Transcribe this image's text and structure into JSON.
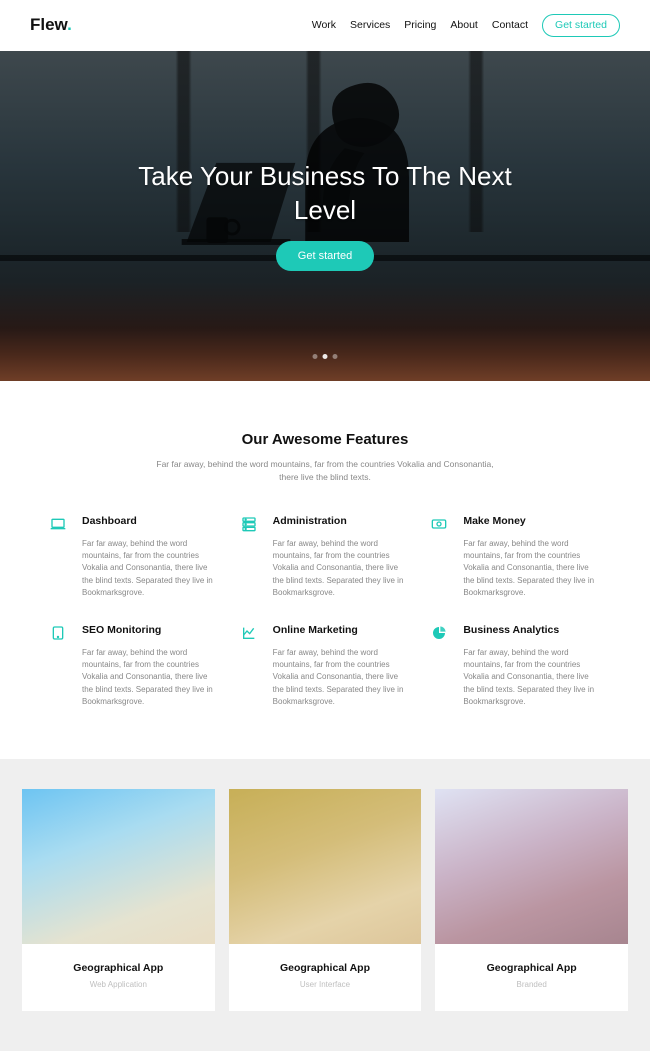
{
  "brand": {
    "name": "Flew",
    "dot": "."
  },
  "nav": {
    "links": [
      "Work",
      "Services",
      "Pricing",
      "About",
      "Contact"
    ],
    "cta": "Get started"
  },
  "hero": {
    "title": "Take Your Business To The Next Level",
    "cta": "Get started"
  },
  "features": {
    "title": "Our Awesome Features",
    "sub": "Far far away, behind the word mountains, far from the countries Vokalia and Consonantia, there live the blind texts.",
    "items": [
      {
        "title": "Dashboard",
        "desc": "Far far away, behind the word mountains, far from the countries Vokalia and Consonantia, there live the blind texts. Separated they live in Bookmarksgrove."
      },
      {
        "title": "Administration",
        "desc": "Far far away, behind the word mountains, far from the countries Vokalia and Consonantia, there live the blind texts. Separated they live in Bookmarksgrove."
      },
      {
        "title": "Make Money",
        "desc": "Far far away, behind the word mountains, far from the countries Vokalia and Consonantia, there live the blind texts. Separated they live in Bookmarksgrove."
      },
      {
        "title": "SEO Monitoring",
        "desc": "Far far away, behind the word mountains, far from the countries Vokalia and Consonantia, there live the blind texts. Separated they live in Bookmarksgrove."
      },
      {
        "title": "Online Marketing",
        "desc": "Far far away, behind the word mountains, far from the countries Vokalia and Consonantia, there live the blind texts. Separated they live in Bookmarksgrove."
      },
      {
        "title": "Business Analytics",
        "desc": "Far far away, behind the word mountains, far from the countries Vokalia and Consonantia, there live the blind texts. Separated they live in Bookmarksgrove."
      }
    ]
  },
  "projects": [
    {
      "title": "Geographical App",
      "cat": "Web Application"
    },
    {
      "title": "Geographical App",
      "cat": "User Interface"
    },
    {
      "title": "Geographical App",
      "cat": "Branded"
    }
  ]
}
